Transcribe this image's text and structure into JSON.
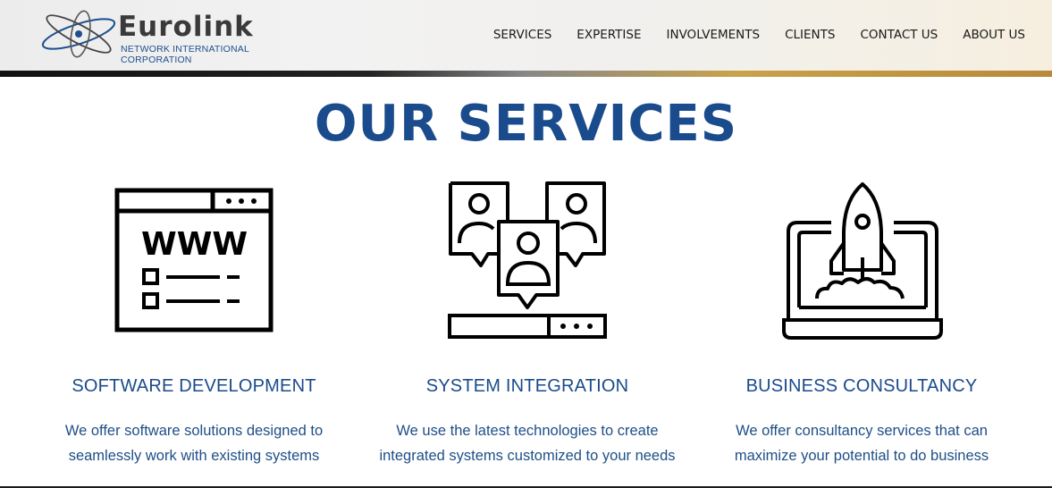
{
  "brand": {
    "name": "Eurolink",
    "tagline": "NETWORK INTERNATIONAL CORPORATION"
  },
  "nav": {
    "items": [
      "SERVICES",
      "EXPERTISE",
      "INVOLVEMENTS",
      "CLIENTS",
      "CONTACT US",
      "ABOUT US"
    ]
  },
  "page": {
    "title": "OUR SERVICES"
  },
  "services": [
    {
      "icon": "web-browser-icon",
      "title": "SOFTWARE DEVELOPMENT",
      "desc_line1": "We offer software solutions designed to",
      "desc_line2": "seamlessly work with existing systems",
      "icon_text": "WWW"
    },
    {
      "icon": "user-network-icon",
      "title": "SYSTEM INTEGRATION",
      "desc_line1": "We use the latest technologies to create",
      "desc_line2": "integrated systems customized to your needs"
    },
    {
      "icon": "rocket-laptop-icon",
      "title": "BUSINESS CONSULTANCY",
      "desc_line1": "We offer consultancy services that can",
      "desc_line2": "maximize your potential to do business"
    }
  ],
  "colors": {
    "accent": "#1a4b8c",
    "text_dark": "#1a1a1a"
  }
}
